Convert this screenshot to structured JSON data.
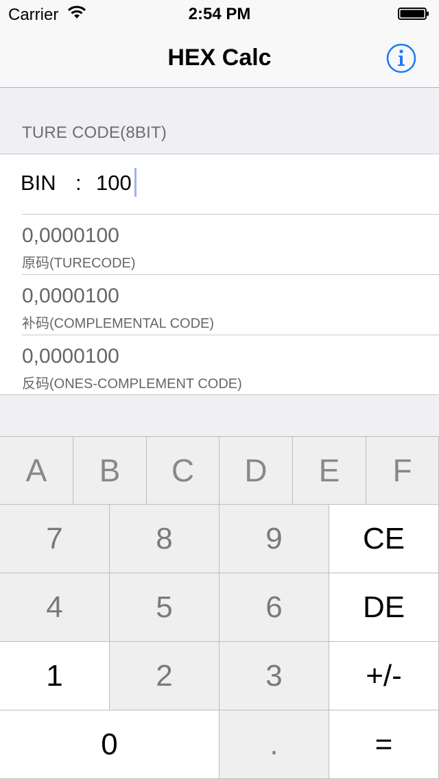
{
  "status_bar": {
    "carrier": "Carrier",
    "time": "2:54 PM"
  },
  "nav": {
    "title": "HEX Calc",
    "info_icon": "info-icon"
  },
  "section_header": "TURE CODE(8BIT)",
  "input": {
    "label": "BIN",
    "colon": ":",
    "value": "100"
  },
  "rows": [
    {
      "value": "0,0000100",
      "label": "原码(TURECODE)"
    },
    {
      "value": "0,0000100",
      "label": "补码(COMPLEMENTAL CODE)"
    },
    {
      "value": "0,0000100",
      "label": "反码(ONES-COMPLEMENT CODE)"
    }
  ],
  "keypad": {
    "hex_row": [
      "A",
      "B",
      "C",
      "D",
      "E",
      "F"
    ],
    "row1": [
      "7",
      "8",
      "9",
      "CE"
    ],
    "row2": [
      "4",
      "5",
      "6",
      "DE"
    ],
    "row3": [
      "1",
      "2",
      "3",
      "+/-"
    ],
    "row4": [
      "0",
      ".",
      "="
    ]
  }
}
